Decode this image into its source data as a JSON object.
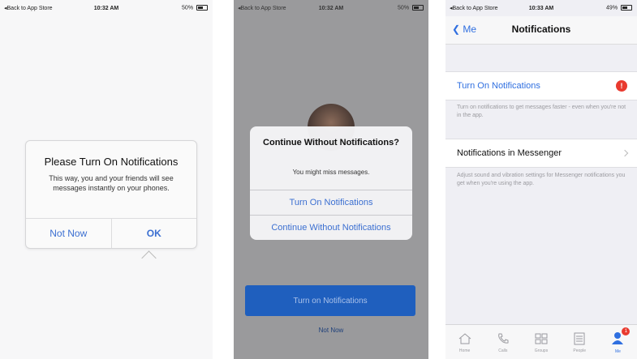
{
  "status_bar": {
    "screen1": {
      "back": "◂Back to App Store",
      "time": "10:32 AM",
      "battery": "50%"
    },
    "screen2": {
      "back": "◂Back to App Store",
      "time": "10:32 AM",
      "battery": "50%"
    },
    "screen3": {
      "back": "◂Back to App Store",
      "time": "10:33 AM",
      "battery": "49%"
    }
  },
  "screen1": {
    "alert": {
      "title": "Please Turn On Notifications",
      "message": "This way, you and your friends will see messages instantly on your phones.",
      "not_now": "Not Now",
      "ok": "OK"
    }
  },
  "screen2": {
    "alert": {
      "title": "Continue Without Notifications?",
      "message": "You might miss messages.",
      "turn_on": "Turn On Notifications",
      "continue": "Continue Without Notifications"
    },
    "primary_button": "Turn on Notifications",
    "not_now": "Not Now"
  },
  "screen3": {
    "nav": {
      "back": "Me",
      "title": "Notifications"
    },
    "turn_on_row": {
      "label": "Turn On Notifications",
      "badge": "!",
      "description": "Turn on notifications to get messages faster - even when you're not in the app."
    },
    "messenger_row": {
      "label": "Notifications in Messenger",
      "description": "Adjust sound and vibration settings for Messenger notifications you get when you're using the app."
    },
    "tabs": [
      {
        "label": "Home",
        "icon": "home-icon"
      },
      {
        "label": "Calls",
        "icon": "phone-icon"
      },
      {
        "label": "Groups",
        "icon": "groups-icon"
      },
      {
        "label": "People",
        "icon": "people-icon"
      },
      {
        "label": "Me",
        "icon": "me-icon",
        "badge": "1"
      }
    ]
  },
  "colors": {
    "accent": "#3b6fd1",
    "badge_red": "#e93a2f",
    "primary_button": "#1f5fbe"
  }
}
